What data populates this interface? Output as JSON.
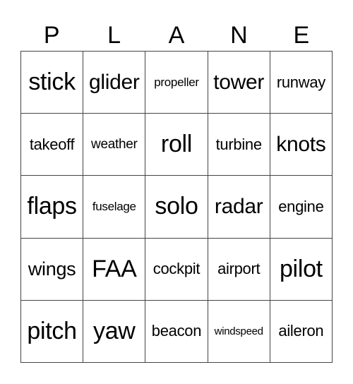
{
  "title_letters": [
    "P",
    "L",
    "A",
    "N",
    "E"
  ],
  "grid": [
    [
      "stick",
      "glider",
      "propeller",
      "tower",
      "runway"
    ],
    [
      "takeoff",
      "weather",
      "roll",
      "turbine",
      "knots"
    ],
    [
      "flaps",
      "fuselage",
      "solo",
      "radar",
      "engine"
    ],
    [
      "wings",
      "FAA",
      "cockpit",
      "airport",
      "pilot"
    ],
    [
      "pitch",
      "yaw",
      "beacon",
      "windspeed",
      "aileron"
    ]
  ]
}
